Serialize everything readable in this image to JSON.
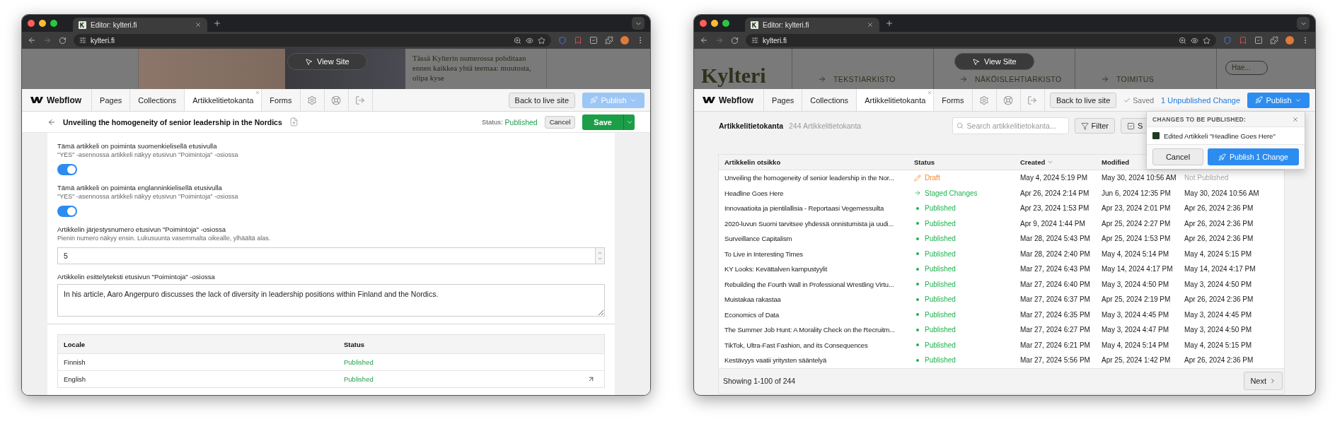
{
  "windows": [
    {
      "kind": "item-editor",
      "browser": {
        "tab_title": "Editor: kylteri.fi",
        "url": "kylteri.fi"
      },
      "preview": {
        "view_site": "View Site",
        "text": "Tässä Kylterin numerossa pohditaan ennen kaikkea yhtä teemaa: muutosta, olipa kyse"
      },
      "toolbar": {
        "brand": "Webflow",
        "tabs": [
          {
            "label": "Pages",
            "selected": false
          },
          {
            "label": "Collections",
            "selected": false
          },
          {
            "label": "Artikkelitietokanta",
            "selected": true
          },
          {
            "label": "Forms",
            "selected": false
          }
        ],
        "back_button": "Back to live site",
        "publish": {
          "label": "Publish",
          "disabled": true
        }
      },
      "editor": {
        "title": "Unveiling the homogeneity of senior leadership in the Nordics",
        "status_label": "Status:",
        "status": "Published",
        "cancel": "Cancel",
        "save": "Save",
        "fields": [
          {
            "kind": "toggle",
            "label": "Tämä artikkeli on poiminta suomenkielisellä etusivulla",
            "help": "\"YES\" -asennossa artikkeli näkyy etusivun \"Poimintoja\" -osiossa",
            "on": true
          },
          {
            "kind": "toggle",
            "label": "Tämä artikkeli on poiminta englanninkielisellä etusivulla",
            "help": "\"YES\" -asennossa artikkeli näkyy etusivun \"Poimintoja\" -osiossa",
            "on": true
          },
          {
            "kind": "number",
            "label": "Artikkelin järjestysnumero etusivun \"Poimintoja\" -osiossa",
            "help": "Pienin numero näkyy ensin. Lukusuunta vasemmalta oikealle, ylhäältä alas.",
            "value": "5"
          },
          {
            "kind": "textarea",
            "label": "Artikkelin esittelyteksti etusivun \"Poimintoja\" -osiossa",
            "value": "In his article, Aaro Angerpuro discusses the lack of diversity in leadership positions within Finland and the Nordics."
          }
        ],
        "locales": {
          "columns": [
            "Locale",
            "Status"
          ],
          "rows": [
            {
              "locale": "Finnish",
              "status": "Published",
              "external_link": false
            },
            {
              "locale": "English",
              "status": "Published",
              "external_link": true
            }
          ]
        }
      }
    },
    {
      "kind": "collection-list",
      "browser": {
        "tab_title": "Editor: kylteri.fi",
        "url": "kylteri.fi"
      },
      "preview": {
        "view_site": "View Site",
        "logo": "Kylteri",
        "links": [
          "TEKSTIARKISTO",
          "NÄKÖISLEHTIARKISTO",
          "TOIMITUS"
        ],
        "search_placeholder": "Hae..."
      },
      "toolbar": {
        "brand": "Webflow",
        "tabs": [
          {
            "label": "Pages",
            "selected": false
          },
          {
            "label": "Collections",
            "selected": false
          },
          {
            "label": "Artikkelitietokanta",
            "selected": true
          },
          {
            "label": "Forms",
            "selected": false
          }
        ],
        "back_button": "Back to live site",
        "saved": "Saved",
        "unpublished": "1 Unpublished Change",
        "publish": {
          "label": "Publish",
          "disabled": false
        }
      },
      "collection": {
        "title": "Artikkelitietokanta",
        "count": "244 Artikkelitietokanta",
        "search_placeholder": "Search artikkelitietokanta...",
        "filter": "Filter",
        "select": "S",
        "columns": [
          {
            "label": "Artikkelin otsikko",
            "sorted": false
          },
          {
            "label": "Status",
            "sorted": false
          },
          {
            "label": "Created",
            "sorted": true
          },
          {
            "label": "Modified",
            "sorted": false
          }
        ],
        "rows": [
          {
            "title": "Unveiling the homogeneity of senior leadership in the Nor...",
            "status": {
              "kind": "draft",
              "text": "Draft"
            },
            "created": "May 4, 2024 5:19 PM",
            "modified": "May 30, 2024 10:56 AM",
            "column_5": "Not Published",
            "not_published": true
          },
          {
            "title": "Headline Goes Here",
            "status": {
              "kind": "staged",
              "text": "Staged Changes"
            },
            "created": "Apr 26, 2024 2:14 PM",
            "modified": "Jun 6, 2024 12:35 PM",
            "column_5": "May 30, 2024 10:56 AM",
            "not_published": false
          },
          {
            "title": "Innovaatioita ja pientilallisia - Reportaasi Vegemessuilta",
            "status": {
              "kind": "published",
              "text": "Published"
            },
            "created": "Apr 23, 2024 1:53 PM",
            "modified": "Apr 23, 2024 2:01 PM",
            "column_5": "Apr 26, 2024 2:36 PM",
            "not_published": false
          },
          {
            "title": "2020-luvun Suomi tarvitsee yhdessä onnistumista ja uudi...",
            "status": {
              "kind": "published",
              "text": "Published"
            },
            "created": "Apr 9, 2024 1:44 PM",
            "modified": "Apr 25, 2024 2:27 PM",
            "column_5": "Apr 26, 2024 2:36 PM",
            "not_published": false
          },
          {
            "title": "Surveillance Capitalism",
            "status": {
              "kind": "published",
              "text": "Published"
            },
            "created": "Mar 28, 2024 5:43 PM",
            "modified": "Apr 25, 2024 1:53 PM",
            "column_5": "Apr 26, 2024 2:36 PM",
            "not_published": false
          },
          {
            "title": "To Live in Interesting Times",
            "status": {
              "kind": "published",
              "text": "Published"
            },
            "created": "Mar 28, 2024 2:40 PM",
            "modified": "May 4, 2024 5:14 PM",
            "column_5": "May 4, 2024 5:15 PM",
            "not_published": false
          },
          {
            "title": "KY Looks: Kevättalven kampustyylit",
            "status": {
              "kind": "published",
              "text": "Published"
            },
            "created": "Mar 27, 2024 6:43 PM",
            "modified": "May 14, 2024 4:17 PM",
            "column_5": "May 14, 2024 4:17 PM",
            "not_published": false
          },
          {
            "title": "Rebuilding the Fourth Wall in Professional Wrestling Virtu...",
            "status": {
              "kind": "published",
              "text": "Published"
            },
            "created": "Mar 27, 2024 6:40 PM",
            "modified": "May 3, 2024 4:50 PM",
            "column_5": "May 3, 2024 4:50 PM",
            "not_published": false
          },
          {
            "title": "Muistakaa rakastaa",
            "status": {
              "kind": "published",
              "text": "Published"
            },
            "created": "Mar 27, 2024 6:37 PM",
            "modified": "Apr 25, 2024 2:19 PM",
            "column_5": "Apr 26, 2024 2:36 PM",
            "not_published": false
          },
          {
            "title": "Economics of Data",
            "status": {
              "kind": "published",
              "text": "Published"
            },
            "created": "Mar 27, 2024 6:35 PM",
            "modified": "May 3, 2024 4:45 PM",
            "column_5": "May 3, 2024 4:45 PM",
            "not_published": false
          },
          {
            "title": "The Summer Job Hunt: A Morality Check on the Recruitm...",
            "status": {
              "kind": "published",
              "text": "Published"
            },
            "created": "Mar 27, 2024 6:27 PM",
            "modified": "May 3, 2024 4:47 PM",
            "column_5": "May 3, 2024 4:50 PM",
            "not_published": false
          },
          {
            "title": "TikTok, Ultra-Fast Fashion, and its Consequences",
            "status": {
              "kind": "published",
              "text": "Published"
            },
            "created": "Mar 27, 2024 6:21 PM",
            "modified": "May 4, 2024 5:14 PM",
            "column_5": "May 4, 2024 5:15 PM",
            "not_published": false
          },
          {
            "title": "Kestävyys vaatii yritysten sääntelyä",
            "status": {
              "kind": "published",
              "text": "Published"
            },
            "created": "Mar 27, 2024 5:56 PM",
            "modified": "Apr 25, 2024 1:42 PM",
            "column_5": "Apr 26, 2024 2:36 PM",
            "not_published": false
          }
        ],
        "footer": "Showing 1-100 of 244",
        "next": "Next"
      },
      "popup": {
        "title": "CHANGES TO BE PUBLISHED:",
        "items": [
          "Edited Artikkeli \"Headline Goes Here\""
        ],
        "cancel": "Cancel",
        "publish": "Publish 1 Change"
      }
    }
  ]
}
